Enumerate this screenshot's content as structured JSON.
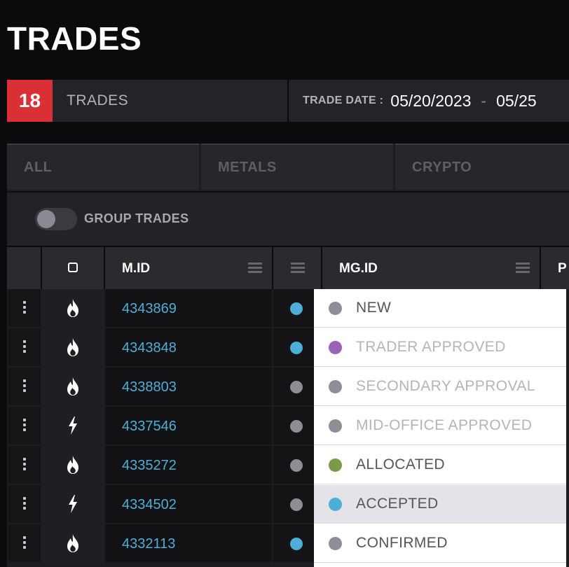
{
  "page": {
    "title": "TRADES"
  },
  "summary": {
    "count": "18",
    "count_label": "TRADES",
    "date_label": "TRADE DATE :",
    "date_from": "05/20/2023",
    "date_sep": "-",
    "date_to": "05/25"
  },
  "filters": {
    "tabs": [
      "ALL",
      "METALS",
      "CRYPTO"
    ]
  },
  "group_trades": {
    "label": "GROUP TRADES",
    "enabled": false
  },
  "table": {
    "columns": {
      "m_id": "M.ID",
      "mg_id": "MG.ID",
      "next": "P"
    },
    "rows": [
      {
        "id": "4343869",
        "icon": "flame-icon",
        "dot_color": "#4eaed8"
      },
      {
        "id": "4343848",
        "icon": "flame-icon",
        "dot_color": "#4eaed8"
      },
      {
        "id": "4338803",
        "icon": "flame-icon",
        "dot_color": "#8e8e94"
      },
      {
        "id": "4337546",
        "icon": "bolt-icon",
        "dot_color": "#8e8e94"
      },
      {
        "id": "4335272",
        "icon": "flame-icon",
        "dot_color": "#8e8e94"
      },
      {
        "id": "4334502",
        "icon": "bolt-icon",
        "dot_color": "#8e8e94"
      },
      {
        "id": "4332113",
        "icon": "flame-icon",
        "dot_color": "#4eaed8"
      }
    ]
  },
  "status_dropdown": {
    "options": [
      {
        "label": "NEW",
        "color": "#8e8e96",
        "text_color": "#55555c",
        "enabled": true
      },
      {
        "label": "TRADER APPROVED",
        "color": "#9a63b8",
        "text_color": "#b4b4ba",
        "enabled": false
      },
      {
        "label": "SECONDARY APPROVAL",
        "color": "#8e8e96",
        "text_color": "#b4b4ba",
        "enabled": false
      },
      {
        "label": "MID-OFFICE APPROVED",
        "color": "#8e8e96",
        "text_color": "#b4b4ba",
        "enabled": false
      },
      {
        "label": "ALLOCATED",
        "color": "#7a9a48",
        "text_color": "#55555c",
        "enabled": true
      },
      {
        "label": "ACCEPTED",
        "color": "#4eaed8",
        "text_color": "#55555c",
        "enabled": true,
        "highlighted": true
      },
      {
        "label": "CONFIRMED",
        "color": "#8e8e96",
        "text_color": "#55555c",
        "enabled": true
      }
    ]
  }
}
